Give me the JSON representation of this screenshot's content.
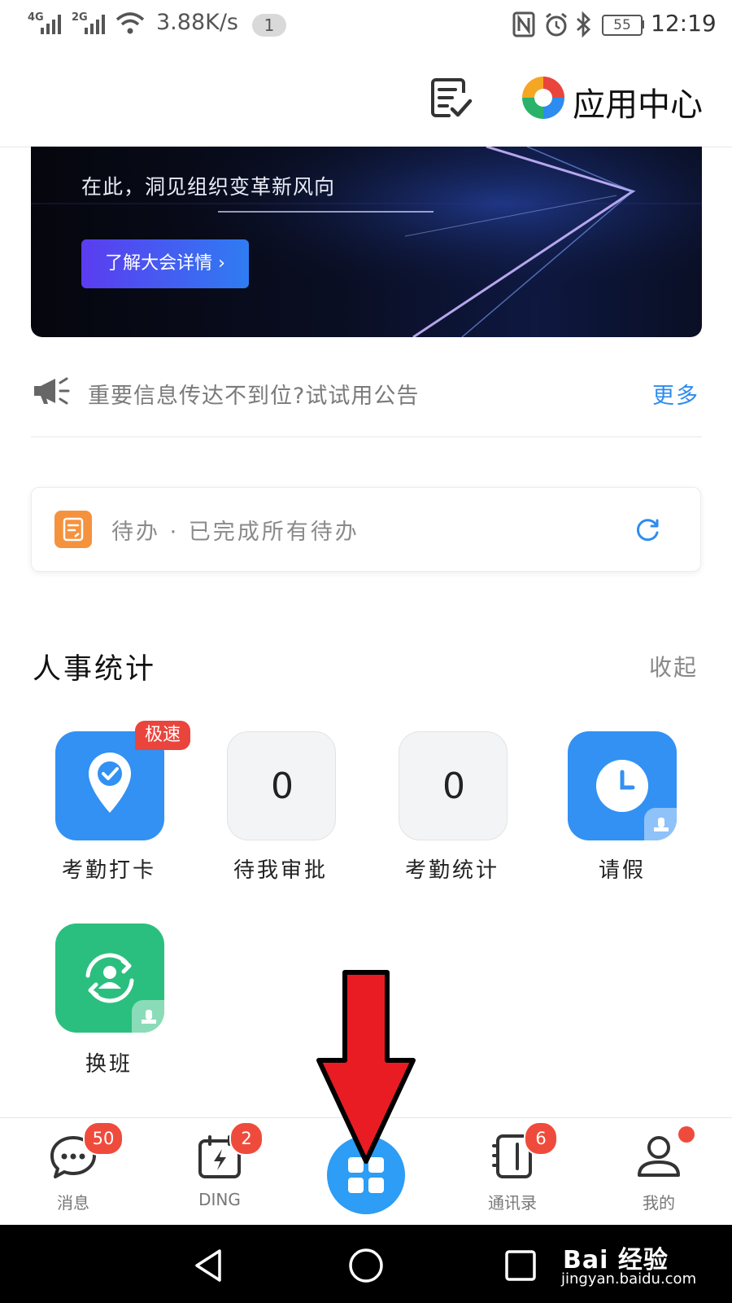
{
  "status_bar": {
    "network_1": "4G",
    "network_2": "2G",
    "speed": "3.88K/s",
    "notification_count": "1",
    "battery": "55",
    "time": "12:19"
  },
  "header": {
    "app_center_label": "应用中心"
  },
  "banner": {
    "subtitle": "在此，洞见组织变革新风向",
    "button_label": "了解大会详情 ›"
  },
  "announcement": {
    "text": "重要信息传达不到位?试试用公告",
    "more_label": "更多"
  },
  "todo": {
    "text": "待办 · 已完成所有待办"
  },
  "hr_section": {
    "title": "人事统计",
    "collapse_label": "收起",
    "items": [
      {
        "label": "考勤打卡",
        "badge": "极速",
        "icon": "location-check-icon"
      },
      {
        "label": "待我审批",
        "value": "0"
      },
      {
        "label": "考勤统计",
        "value": "0"
      },
      {
        "label": "请假",
        "icon": "clock-icon"
      },
      {
        "label": "换班",
        "icon": "swap-person-icon"
      }
    ]
  },
  "bottom_nav": {
    "items": [
      {
        "label": "消息",
        "badge": "50",
        "icon": "chat-bubble-icon"
      },
      {
        "label": "DING",
        "badge": "2",
        "icon": "ding-calendar-icon"
      },
      {
        "label": "",
        "icon": "grid-icon"
      },
      {
        "label": "通讯录",
        "badge": "6",
        "icon": "contacts-book-icon"
      },
      {
        "label": "我的",
        "icon": "person-icon"
      }
    ]
  },
  "watermark": {
    "brand": "Bai  经验",
    "url": "jingyan.baidu.com"
  },
  "colors": {
    "accent": "#2d8cf0",
    "tile_blue": "#3291f3",
    "tile_green": "#2bbf7f",
    "badge_red": "#ef4b3c",
    "arrow_red": "#e91c24"
  }
}
